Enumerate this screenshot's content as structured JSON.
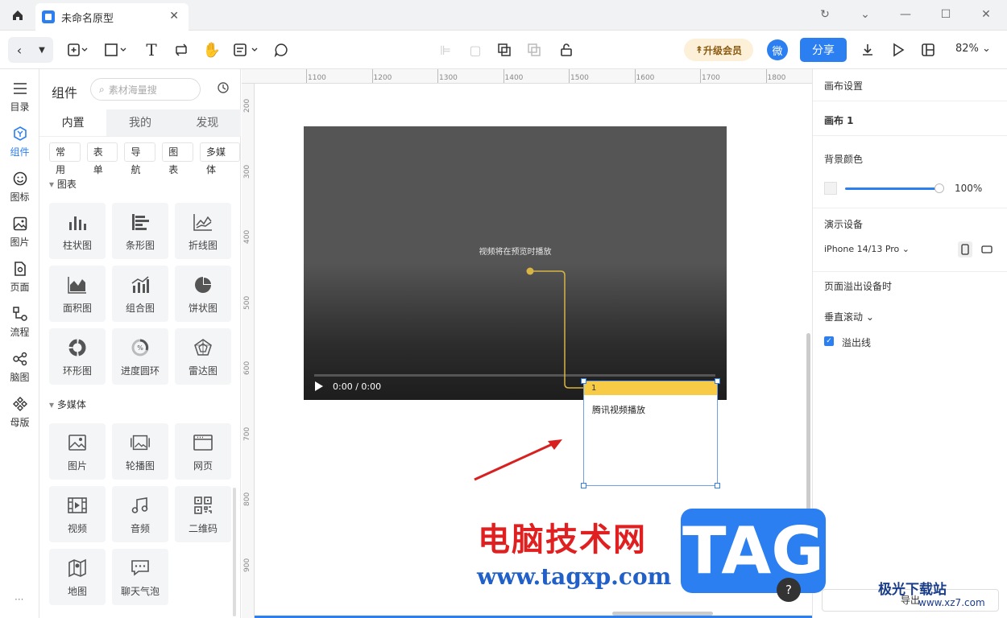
{
  "tab": {
    "title": "未命名原型"
  },
  "toolbar": {
    "upgrade": "升级会员",
    "wei": "微",
    "share": "分享",
    "zoom": "82%"
  },
  "leftnav": [
    {
      "label": "目录",
      "icon": "list-icon"
    },
    {
      "label": "组件",
      "icon": "component-icon"
    },
    {
      "label": "图标",
      "icon": "smiley-icon"
    },
    {
      "label": "图片",
      "icon": "image-icon"
    },
    {
      "label": "页面",
      "icon": "page-icon"
    },
    {
      "label": "流程",
      "icon": "flow-icon"
    },
    {
      "label": "脑图",
      "icon": "mindmap-icon"
    },
    {
      "label": "母版",
      "icon": "master-icon"
    }
  ],
  "panel": {
    "title": "组件",
    "search_placeholder": "素材海量搜",
    "tabs": [
      "内置",
      "我的",
      "发现"
    ],
    "chips": [
      "常用",
      "表单",
      "导航",
      "图表",
      "多媒体"
    ],
    "section_chart": "图表",
    "charts": [
      "柱状图",
      "条形图",
      "折线图",
      "面积图",
      "组合图",
      "饼状图",
      "环形图",
      "进度圆环",
      "雷达图"
    ],
    "section_media": "多媒体",
    "media": [
      "图片",
      "轮播图",
      "网页",
      "视频",
      "音频",
      "二维码",
      "地图",
      "聊天气泡"
    ]
  },
  "ruler": {
    "x": [
      "1100",
      "1200",
      "1300",
      "1400",
      "1500",
      "1600",
      "1700",
      "1800"
    ],
    "y": [
      "200",
      "300",
      "400",
      "500",
      "600",
      "700",
      "800",
      "900"
    ]
  },
  "video": {
    "message": "视频将在预览时播放",
    "time": "0:00 / 0:00"
  },
  "note": {
    "number": "1",
    "text": "腾讯视频播放"
  },
  "right": {
    "canvas_settings": "画布设置",
    "canvas_name": "画布 1",
    "bg_color": "背景颜色",
    "opacity": "100%",
    "device_title": "演示设备",
    "device": "iPhone 14/13 Pro",
    "overflow_title": "页面溢出设备时",
    "scroll": "垂直滚动",
    "overflow_line": "溢出线",
    "export": "导出"
  },
  "watermark": {
    "cn": "电脑技术网",
    "url": "www.tagxp.com",
    "tag": "TAG",
    "site": "极光下载站",
    "site_url": "www.xz7.com"
  }
}
